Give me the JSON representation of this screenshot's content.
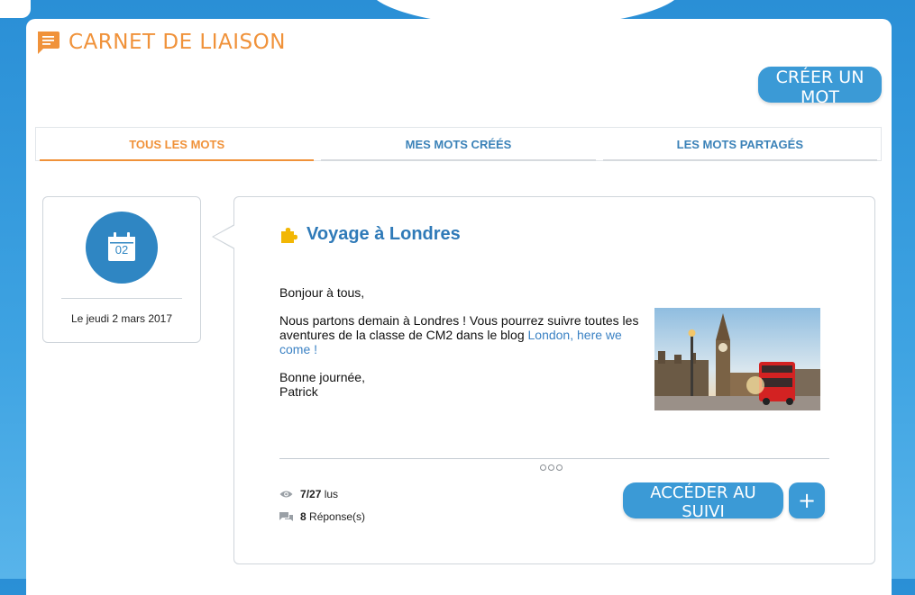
{
  "app": {
    "title": "CARNET DE LIAISON",
    "create_button": "CRÉER UN MOT"
  },
  "tabs": [
    {
      "label": "TOUS LES MOTS",
      "active": true
    },
    {
      "label": "MES MOTS CRÉÉS",
      "active": false
    },
    {
      "label": "LES MOTS PARTAGÉS",
      "active": false
    }
  ],
  "message": {
    "day_number": "02",
    "date_label": "Le jeudi 2 mars 2017",
    "title": "Voyage à Londres",
    "greeting": "Bonjour à tous,",
    "body_text": "Nous partons demain à Londres ! Vous pourrez suivre toutes les aventures de la classe de CM2 dans le blog ",
    "link_text": "London, here we come !",
    "closing": "Bonne journée,",
    "signature": "Patrick",
    "reads_count": "7",
    "reads_total": "/27",
    "reads_suffix": " lus",
    "responses_count": "8",
    "responses_suffix": " Réponse(s)",
    "follow_button": "ACCÉDER AU SUIVI",
    "plus_button": "+"
  },
  "colors": {
    "accent_orange": "#f0923a",
    "primary_blue": "#3b9ad6",
    "title_blue": "#2f7ab8"
  }
}
